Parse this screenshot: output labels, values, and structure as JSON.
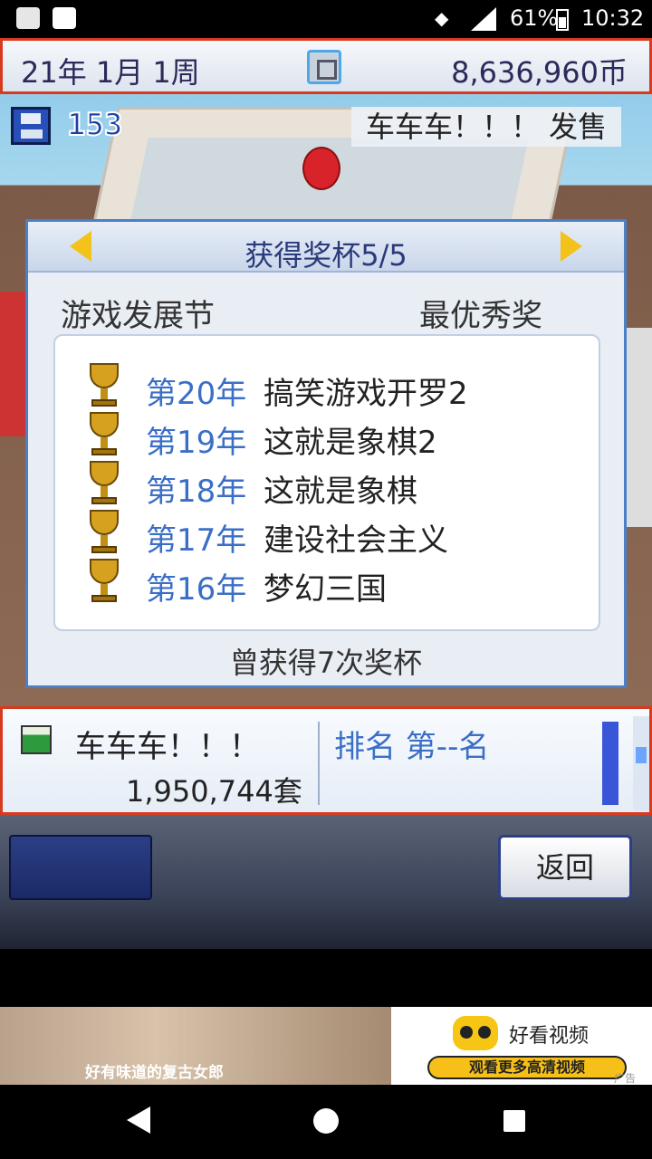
{
  "status_bar": {
    "battery": "61%",
    "time": "10:32"
  },
  "top_bar": {
    "date": "21年 1月 1周",
    "money": "8,636,960币"
  },
  "save_count": "153",
  "release_banner": "车车车！！！ 发售",
  "dialog": {
    "title": "获得奖杯5/5",
    "festival": "游戏发展节",
    "award": "最优秀奖",
    "trophies": [
      {
        "year": "第20年",
        "game": "搞笑游戏开罗2"
      },
      {
        "year": "第19年",
        "game": "这就是象棋2"
      },
      {
        "year": "第18年",
        "game": "这就是象棋"
      },
      {
        "year": "第17年",
        "game": "建设社会主义"
      },
      {
        "year": "第16年",
        "game": "梦幻三国"
      }
    ],
    "total": "曾获得7次奖杯"
  },
  "info_panel": {
    "game_title": "车车车！！！",
    "sales": "1,950,744套",
    "rank": "排名 第--名"
  },
  "buttons": {
    "back": "返回"
  },
  "ad": {
    "caption": "好有味道的复古女郎",
    "brand": "好看视频",
    "cta": "观看更多高清视频",
    "tag": "广告"
  },
  "colors": {
    "accent_border": "#d83a1e",
    "year_blue": "#3b6fc6",
    "trophy_gold": "#d6a11e"
  }
}
